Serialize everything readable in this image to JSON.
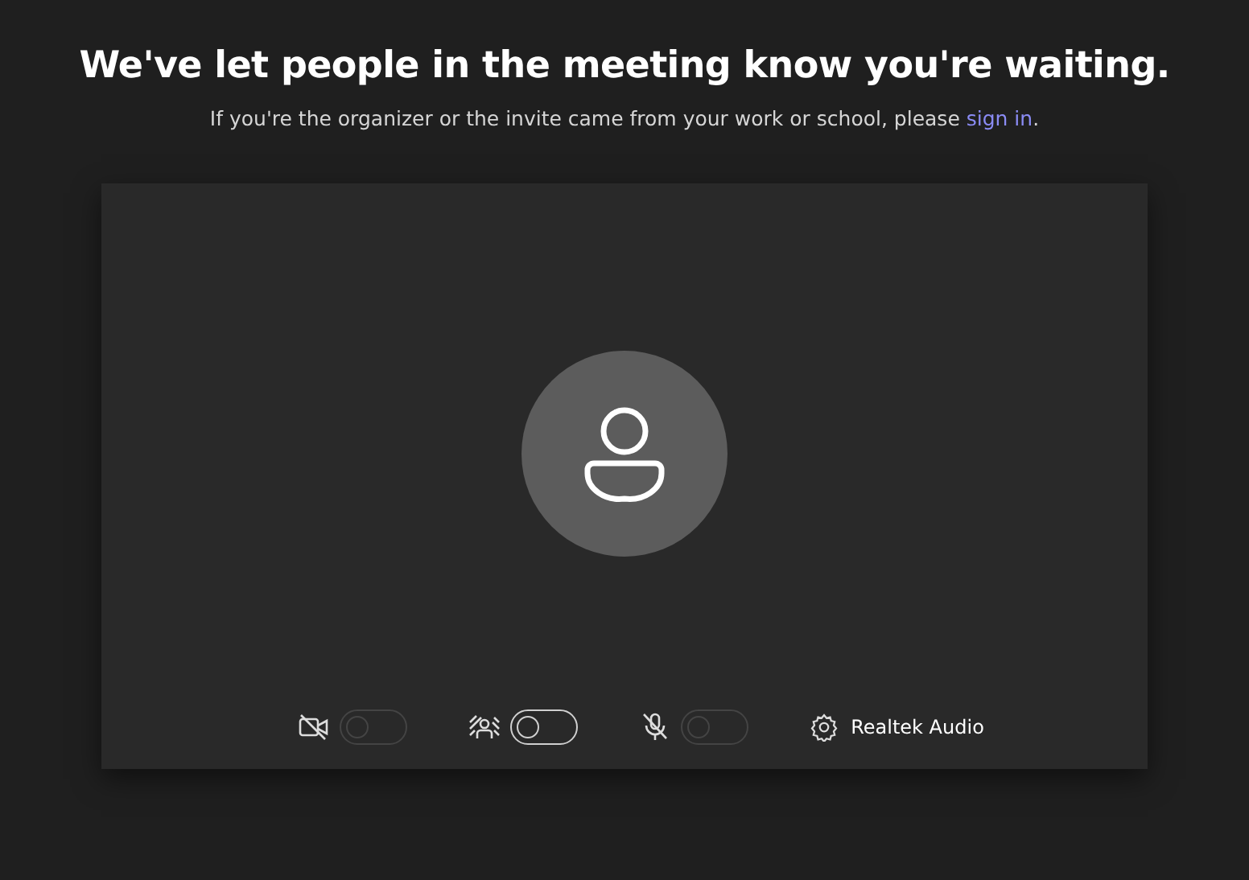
{
  "heading": "We've let people in the meeting know you're waiting.",
  "subtitle": {
    "before": "If you're the organizer or the invite came from your work or school, please ",
    "link": "sign in",
    "after": "."
  },
  "controls": [
    {
      "kind": "camera",
      "on": false,
      "disabled": true
    },
    {
      "kind": "background",
      "on": false,
      "disabled": false
    },
    {
      "kind": "microphone",
      "on": false,
      "disabled": true
    }
  ],
  "audio_device": "Realtek Audio"
}
